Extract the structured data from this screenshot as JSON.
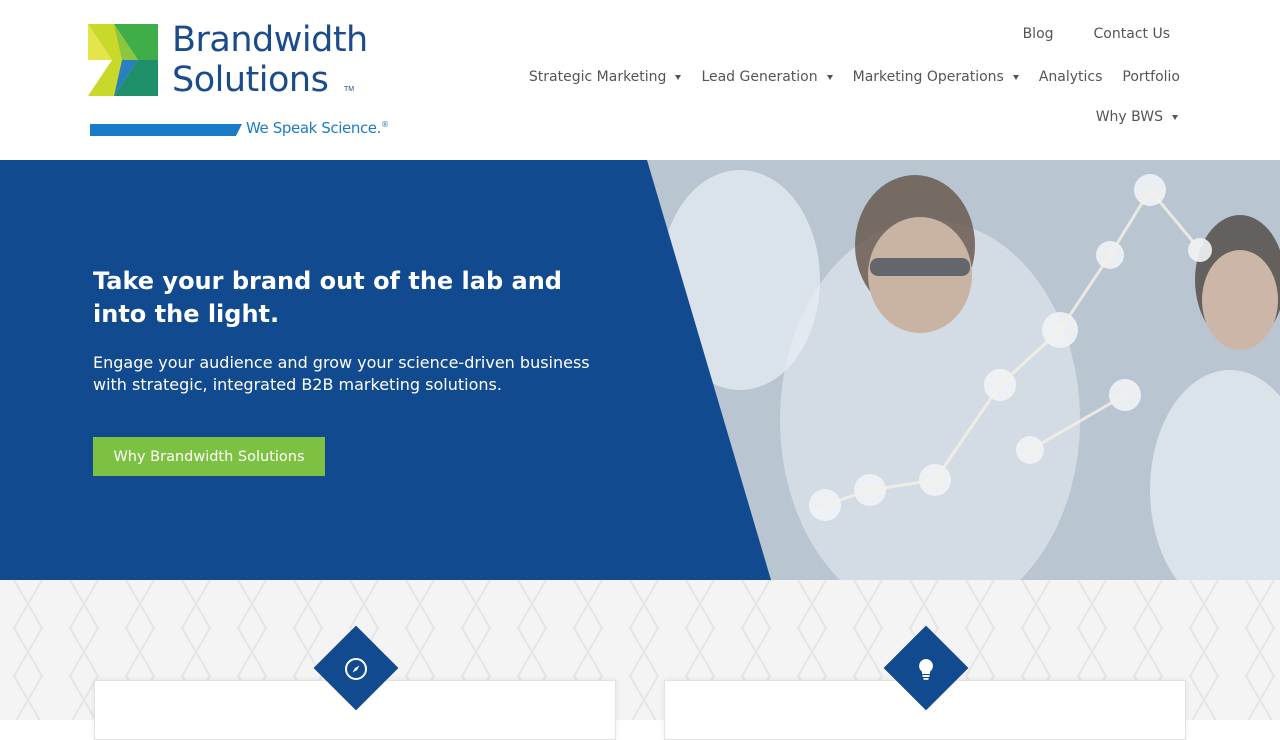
{
  "brand": {
    "line1": "Brandwidth",
    "line2": "Solutions",
    "tm": "TM",
    "tagline": "We Speak Science.",
    "registered": "®"
  },
  "nav": {
    "top": [
      "Blog",
      "Contact Us"
    ],
    "main": [
      {
        "label": "Strategic Marketing",
        "dropdown": true
      },
      {
        "label": "Lead Generation",
        "dropdown": true
      },
      {
        "label": "Marketing Operations",
        "dropdown": true
      },
      {
        "label": "Analytics",
        "dropdown": false
      },
      {
        "label": "Portfolio",
        "dropdown": false
      }
    ],
    "why": "Why BWS"
  },
  "hero": {
    "title": "Take your brand out of the lab and into the light.",
    "subtitle": "Engage your audience and grow your science-driven business with strategic, integrated B2B marketing solutions.",
    "cta": "Why Brandwidth Solutions"
  },
  "features": {
    "icons": [
      "compass-icon",
      "lightbulb-icon"
    ]
  },
  "colors": {
    "brand_blue": "#124a8f",
    "accent_green": "#7dc142",
    "tagline_blue": "#1a7cc8"
  }
}
